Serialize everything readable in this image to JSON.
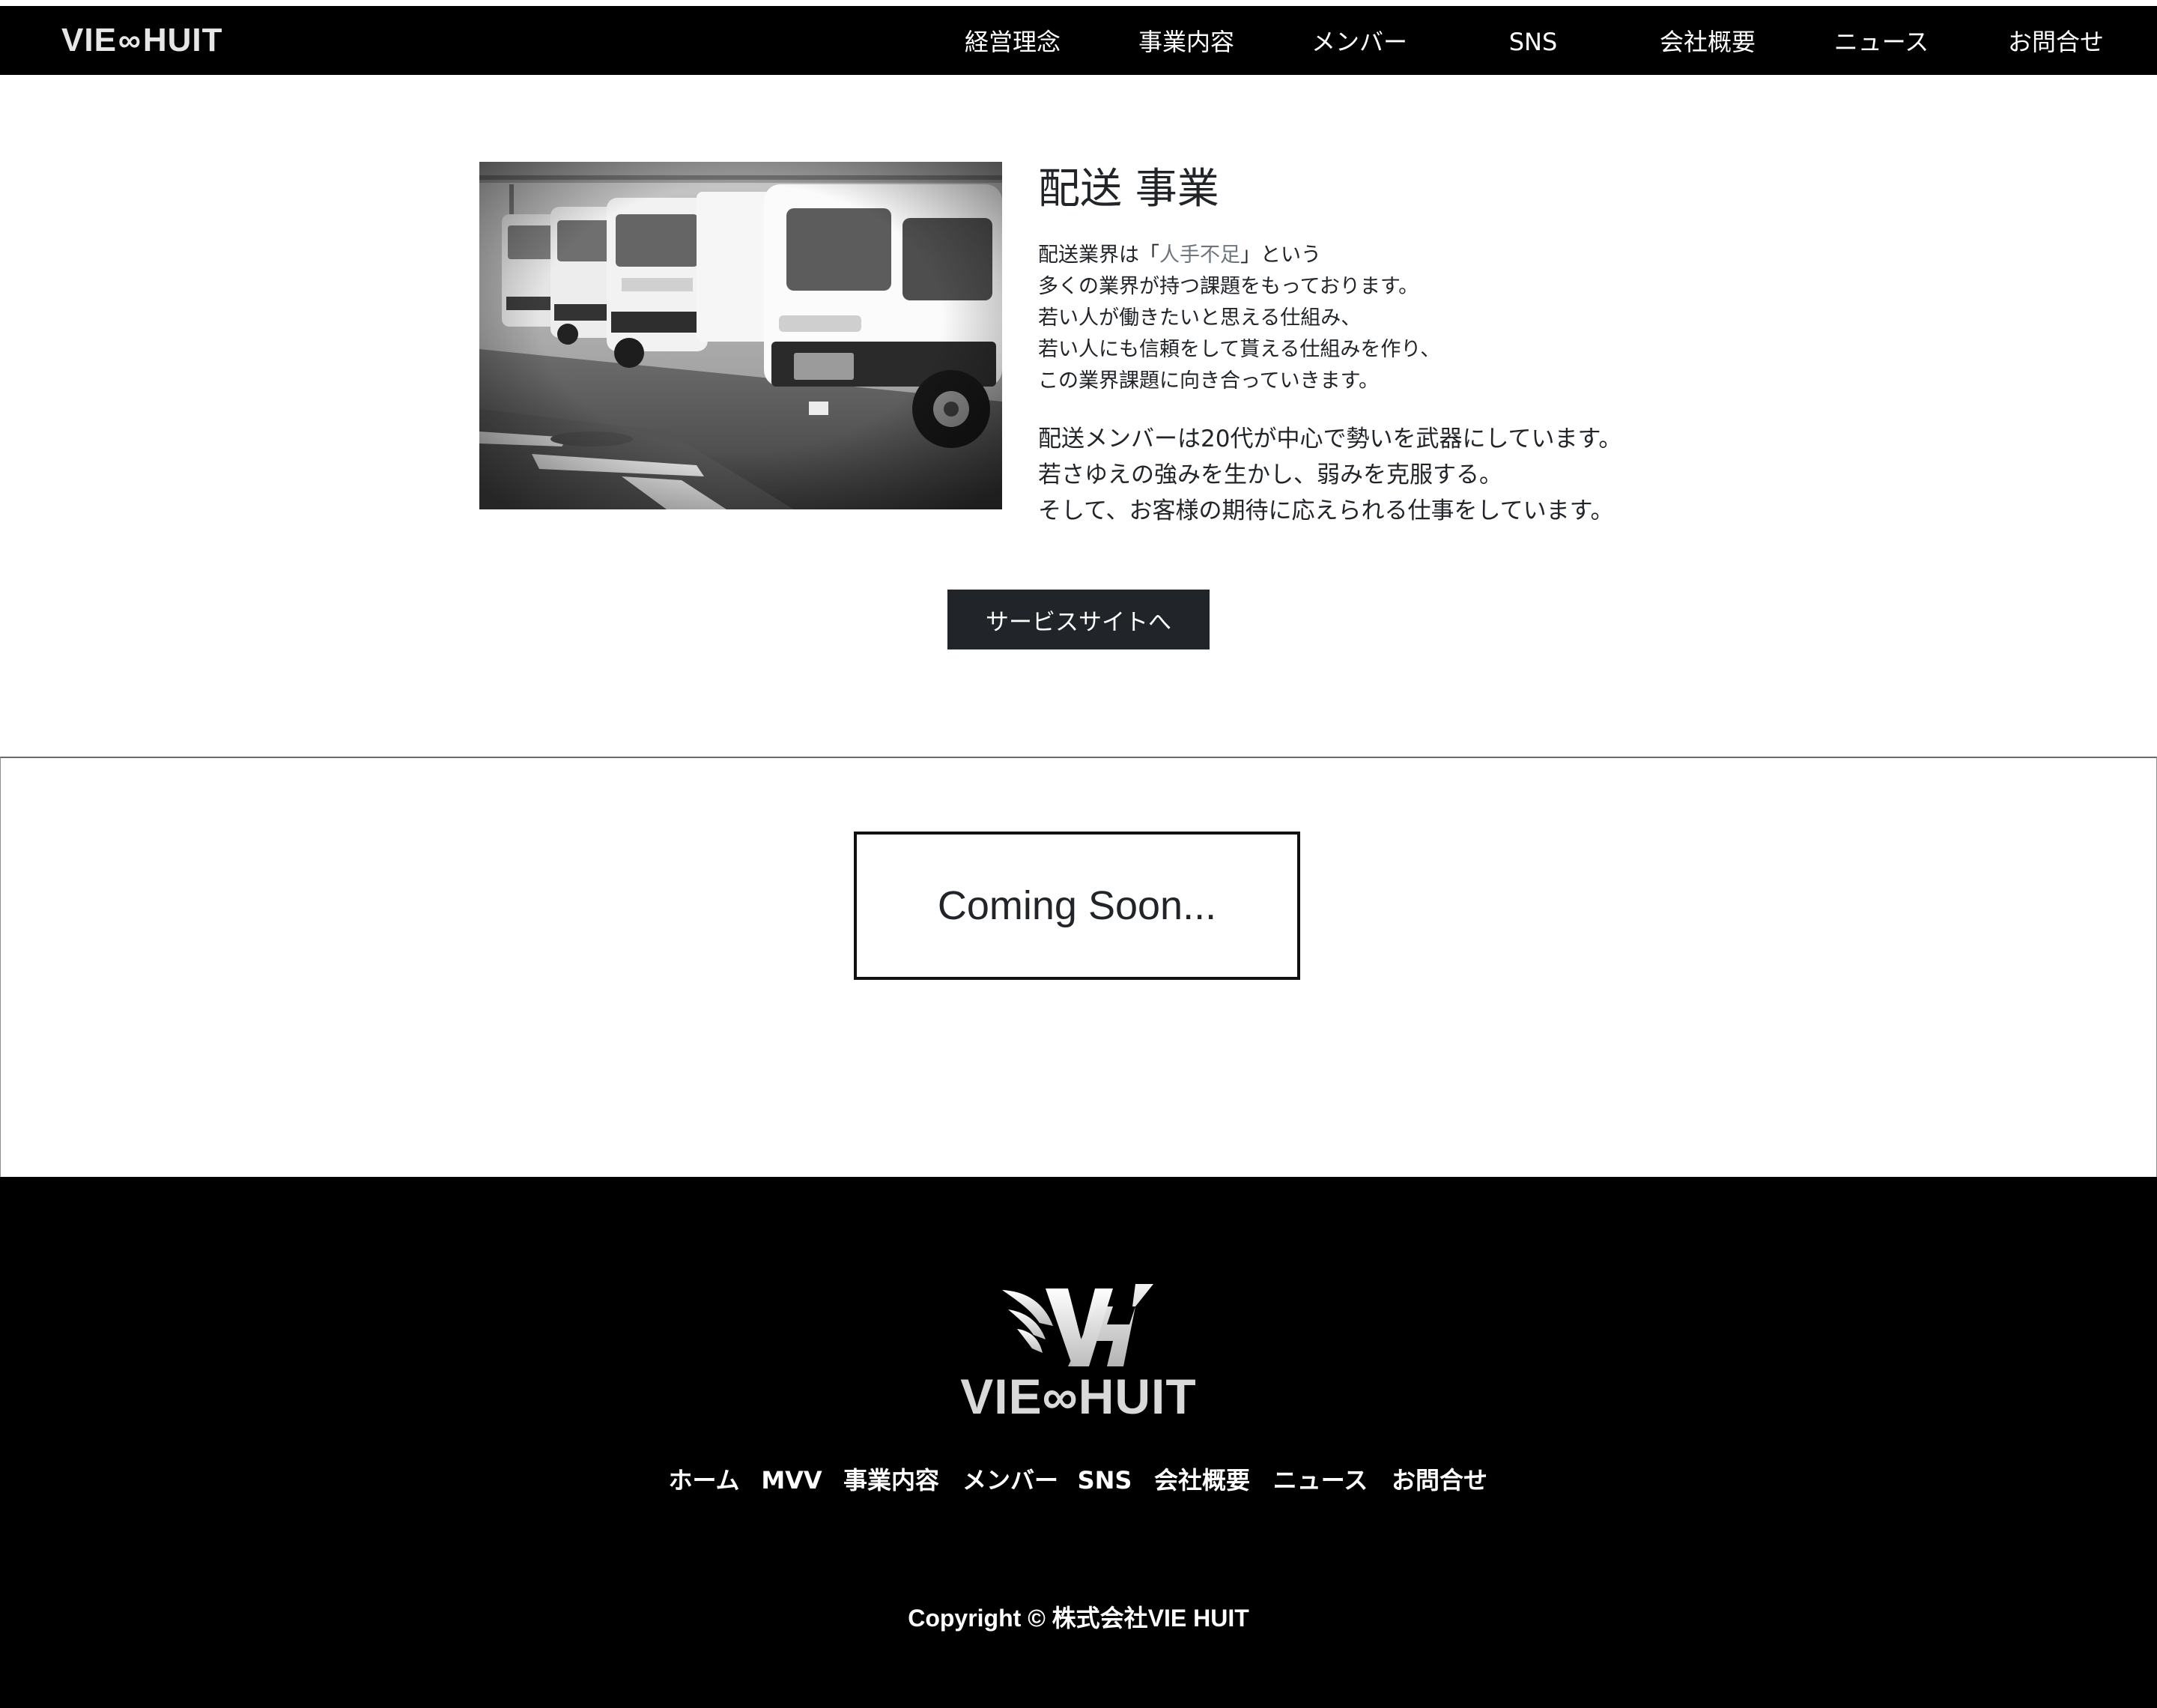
{
  "header": {
    "logo": {
      "left": "VIE",
      "infinity": "∞",
      "right": "HUIT"
    },
    "nav": [
      {
        "label": "経営理念"
      },
      {
        "label": "事業内容"
      },
      {
        "label": "メンバー"
      },
      {
        "label": "SNS"
      },
      {
        "label": "会社概要"
      },
      {
        "label": "ニュース"
      },
      {
        "label": "お問合せ"
      }
    ]
  },
  "delivery": {
    "title": "配送 事業",
    "paragraph1": {
      "line1_pre": "配送業界は「",
      "line1_highlight": "人手不足",
      "line1_post": "」という",
      "line2": "多くの業界が持つ課題をもっております。",
      "line3": "若い人が働きたいと思える仕組み、",
      "line4": "若い人にも信頼をして貰える仕組みを作り、",
      "line5": "この業界課題に向き合っていきます。"
    },
    "paragraph2": {
      "line1": "配送メンバーは20代が中心で勢いを武器にしています。",
      "line2": "若さゆえの強みを生かし、弱みを克服する。",
      "line3": "そして、お客様の期待に応えられる仕事をしています。"
    },
    "button_label": "サービスサイトへ"
  },
  "coming_soon": {
    "text": "Coming Soon..."
  },
  "footer": {
    "wordmark": {
      "left": "VIE",
      "infinity": "∞",
      "right": "HUIT"
    },
    "nav": [
      {
        "label": "ホーム"
      },
      {
        "label": "MVV"
      },
      {
        "label": "事業内容"
      },
      {
        "label": "メンバー"
      },
      {
        "label": "SNS"
      },
      {
        "label": "会社概要"
      },
      {
        "label": "ニュース"
      },
      {
        "label": "お問合せ"
      }
    ],
    "copyright": "Copyright © 株式会社VIE HUIT"
  },
  "colors": {
    "navbar_bg": "#000000",
    "button_bg": "#212529",
    "text": "#212529",
    "highlight_text": "#6c757d",
    "footer_bg": "#000000"
  },
  "icons": {
    "footer_emblem": "winged-vh-logo-icon",
    "photo": "delivery-trucks-image"
  }
}
